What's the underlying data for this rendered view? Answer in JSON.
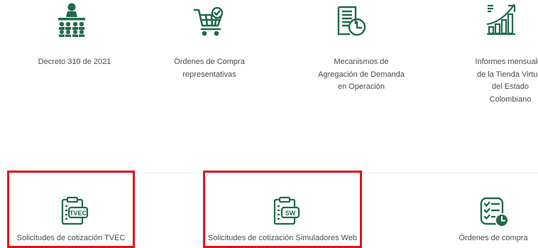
{
  "top_row": [
    {
      "icon": "presentation-audience-icon",
      "label": "Decreto 310 de 2021"
    },
    {
      "icon": "shopping-cart-check-icon",
      "label": "Órdenes de Compra representativas"
    },
    {
      "icon": "document-clock-icon",
      "label": "Mecanismos de Agregación de Demanda en Operación"
    },
    {
      "icon": "growth-chart-icon",
      "label": "Informes mensuales de la Tienda Virtual del Estado Colombiano"
    }
  ],
  "bottom_row": [
    {
      "icon": "clipboard-tvec-icon",
      "badge": "TVEC",
      "label": "Solicitudes de cotización TVEC"
    },
    {
      "icon": "clipboard-sw-icon",
      "badge": "SW",
      "label": "Solicitudes de cotización Simuladores Web"
    },
    {
      "icon": "checklist-clock-icon",
      "label": "Órdenes de compra"
    }
  ],
  "colors": {
    "icon_green": "#1f6b4c",
    "highlight_red": "#e0121c"
  }
}
